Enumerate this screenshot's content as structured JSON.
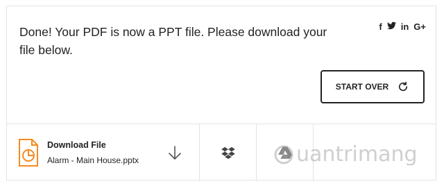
{
  "message": "Done! Your PDF is now a PPT file. Please download your file below.",
  "social": {
    "facebook": "f",
    "twitter": "t",
    "linkedin": "in",
    "googleplus": "G+"
  },
  "start_over_label": "START OVER",
  "file": {
    "title": "Download File",
    "name": "Alarm - Main House.pptx"
  },
  "icons": {
    "file": "pie-chart-file-icon",
    "download": "download-arrow-icon",
    "dropbox": "dropbox-icon",
    "drive": "google-drive-icon",
    "refresh": "refresh-icon"
  },
  "colors": {
    "file_icon": "#f58a1f",
    "text": "#222222",
    "border": "#e3e3e3"
  },
  "watermark": "uantrimang"
}
